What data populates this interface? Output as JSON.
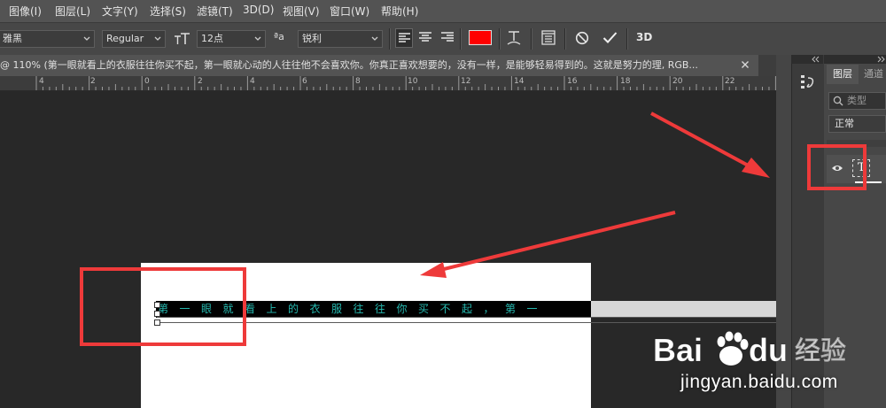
{
  "menu": {
    "items": [
      "图像(I)",
      "图层(L)",
      "文字(Y)",
      "选择(S)",
      "滤镜(T)",
      "3D(D)",
      "视图(V)",
      "窗口(W)",
      "帮助(H)"
    ]
  },
  "options": {
    "font_family": "雅黑",
    "font_style": "Regular",
    "font_size": "12点",
    "aa_label": "ªa",
    "antialias": "锐利",
    "three_d_label": "3D",
    "text_color": "#ff0000"
  },
  "document": {
    "tab_title": "@ 110% (第一眼就看上的衣服往往你买不起，第一眼就心动的人往往他不会喜欢你。你真正喜欢想要的，没有一样，是能够轻易得到的。这就是努力的理, RGB...",
    "text_content": "第一眼就看上的衣服往往你买不起，第一"
  },
  "ruler": {
    "labels": [
      "4",
      "2",
      "0",
      "2",
      "4",
      "6",
      "8",
      "10",
      "12",
      "14",
      "16",
      "18",
      "20",
      "22"
    ]
  },
  "layers_panel": {
    "tab_layers": "图层",
    "tab_channels": "通道",
    "filter_placeholder": "类型",
    "blend_mode": "正常",
    "layer_type_glyph": "T"
  },
  "annotation_color": "#ee3a3a",
  "watermark": {
    "brand_bai": "Bai",
    "brand_du": "du",
    "brand_jingyan": "经验",
    "url": "jingyan.baidu.com"
  }
}
